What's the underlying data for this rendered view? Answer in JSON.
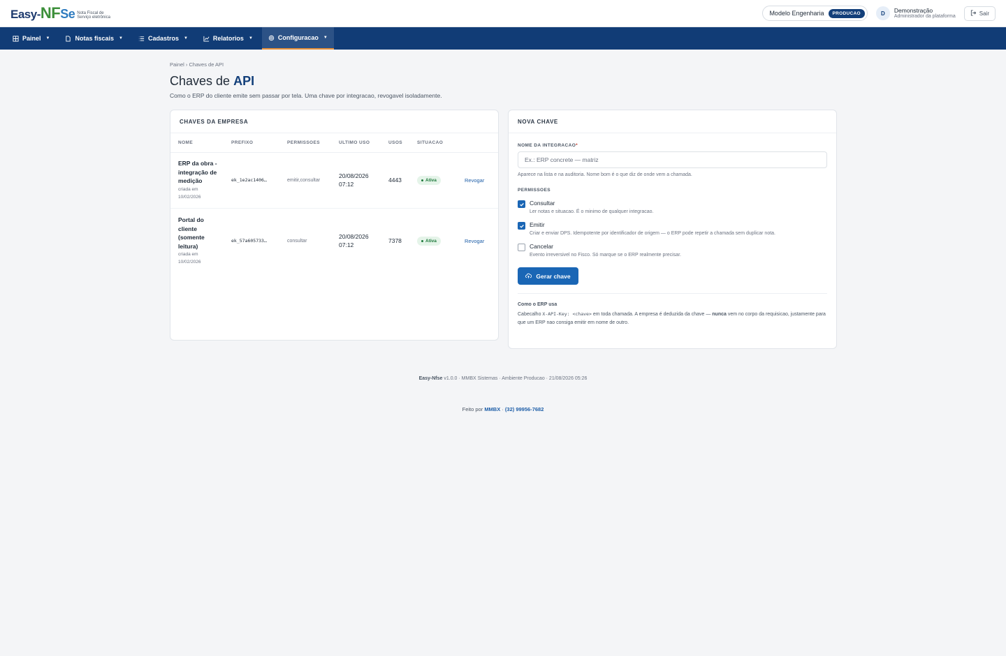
{
  "brand": {
    "logo_prefix": "Easy-",
    "logo_nf": "NF",
    "logo_se": "Se",
    "tagline": "Nota Fiscal de Serviço eletrônica"
  },
  "header": {
    "company": "Modelo Engenharia",
    "env": "PRODUCAO",
    "user_initial": "D",
    "user_name": "Demonstração",
    "user_role": "Administrador da plataforma",
    "logout": "Sair"
  },
  "nav": [
    {
      "label": "Painel",
      "icon": "dashboard-icon"
    },
    {
      "label": "Notas fiscais",
      "icon": "document-icon"
    },
    {
      "label": "Cadastros",
      "icon": "list-icon"
    },
    {
      "label": "Relatorios",
      "icon": "chart-icon"
    },
    {
      "label": "Configuracao",
      "icon": "gear-icon",
      "active": true
    }
  ],
  "breadcrumb": "Painel › Chaves de API",
  "title": {
    "prefix": "Chaves de",
    "highlight": "API"
  },
  "subtitle": "Como o ERP do cliente emite sem passar por tela. Uma chave por integracao, revogavel isoladamente.",
  "keys_card": {
    "title": "CHAVES DA EMPRESA",
    "columns": [
      "NOME",
      "PREFIXO",
      "PERMISSOES",
      "ULTIMO USO",
      "USOS",
      "SITUACAO"
    ],
    "rows": [
      {
        "name": "ERP da obra - integração de medição",
        "created": "criada em 10/02/2026",
        "prefix": "ek_1e2ac1406…",
        "permissions": "emitir,consultar",
        "last_use": "20/08/2026 07:12",
        "uses": "4443",
        "status": "Ativa",
        "action": "Revogar"
      },
      {
        "name": "Portal do cliente (somente leitura)",
        "created": "criada em 10/02/2026",
        "prefix": "ek_57a605733…",
        "permissions": "consultar",
        "last_use": "20/08/2026 07:12",
        "uses": "7378",
        "status": "Ativa",
        "action": "Revogar"
      }
    ]
  },
  "new_key": {
    "title": "NOVA CHAVE",
    "name_label": "NOME DA INTEGRACAO",
    "name_placeholder": "Ex.: ERP concrete — matriz",
    "name_hint": "Aparece na lista e na auditoria. Nome bom é o que diz de onde vem a chamada.",
    "perm_label": "PERMISSOES",
    "perms": [
      {
        "title": "Consultar",
        "desc": "Ler notas e situacao. É o minimo de qualquer integracao.",
        "checked": true
      },
      {
        "title": "Emitir",
        "desc": "Criar e enviar DPS. Idempotente por identificador de origem — o ERP pode repetir a chamada sem duplicar nota.",
        "checked": true
      },
      {
        "title": "Cancelar",
        "desc": "Evento irreversivel no Fisco. Só marque se o ERP realmente precisar.",
        "checked": false
      }
    ],
    "button": "Gerar chave",
    "erp_title": "Como o ERP usa",
    "erp_text_1": "Cabecalho",
    "erp_code": "X-API-Key: <chave>",
    "erp_text_2": "em toda chamada. A empresa é deduzida da chave —",
    "erp_strong": "nunca",
    "erp_text_3": "vem no corpo da requisicao, justamente para que um ERP nao consiga emitir em nome de outro."
  },
  "footer": {
    "app": "Easy-Nfse",
    "rest": "v1.0.0 · MMBX Sistemas · Ambiente Producao · 21/08/2026 05:26",
    "made_by": "Feito por",
    "company_link": "MMBX",
    "sep": "·",
    "phone": "(32) 99956-7682"
  }
}
